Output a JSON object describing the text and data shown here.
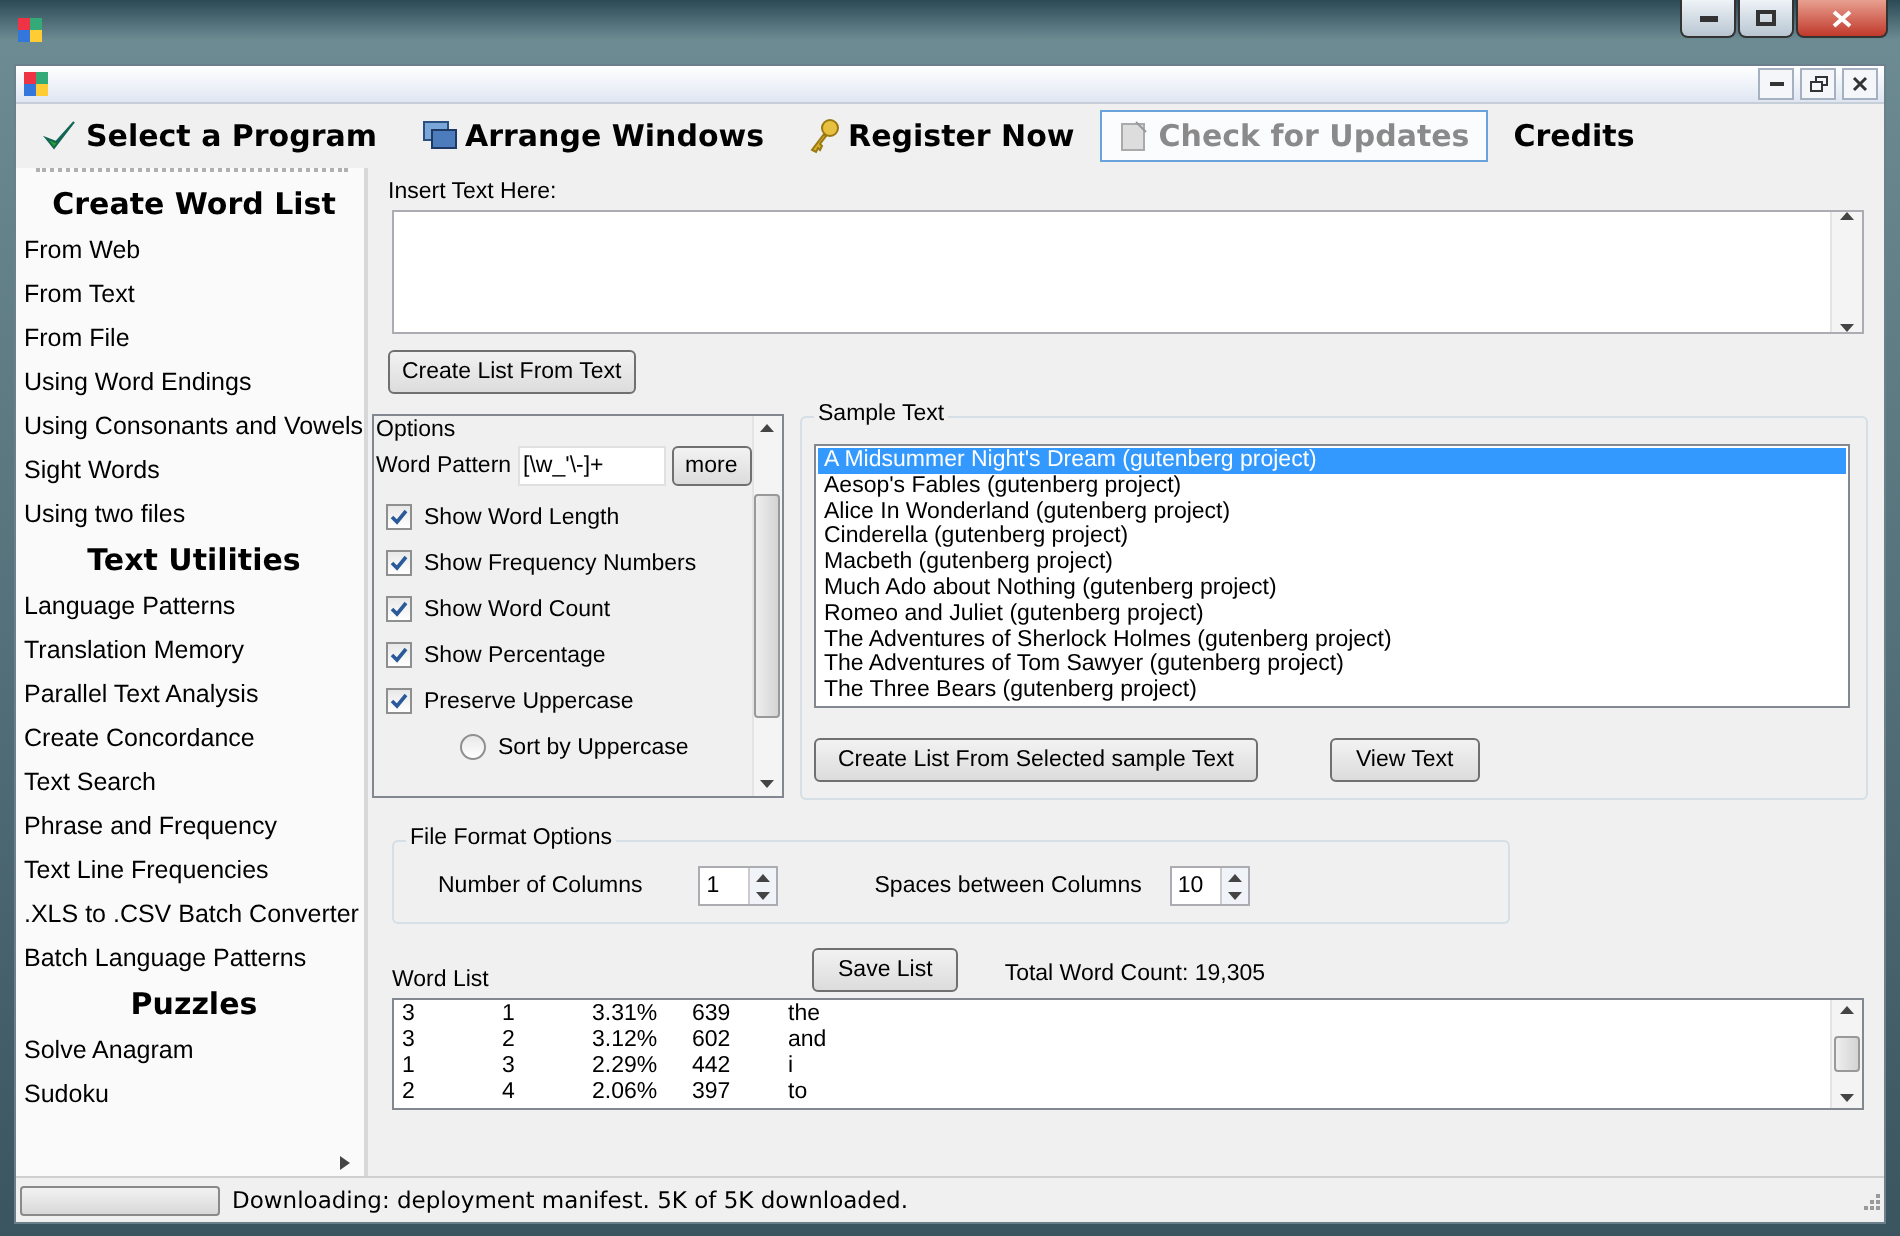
{
  "menu": [
    {
      "label": "Select a Program",
      "kind": "check",
      "selected": false,
      "disabled": false
    },
    {
      "label": "Arrange Windows",
      "kind": "windows",
      "selected": false,
      "disabled": false
    },
    {
      "label": "Register Now",
      "kind": "key",
      "selected": false,
      "disabled": false
    },
    {
      "label": "Check for Updates",
      "kind": "update",
      "selected": true,
      "disabled": true
    },
    {
      "label": "Credits",
      "kind": "plain",
      "selected": false,
      "disabled": false
    }
  ],
  "sidebar": {
    "sections": [
      {
        "heading": "Create Word List",
        "items": [
          "From Web",
          "From Text",
          "From File",
          "Using Word Endings",
          "Using Consonants and Vowels",
          "Sight Words",
          "Using two files"
        ]
      },
      {
        "heading": "Text Utilities",
        "items": [
          "Language Patterns",
          "Translation Memory",
          "Parallel Text Analysis",
          "Create Concordance",
          "Text Search",
          "Phrase and Frequency",
          "Text Line Frequencies",
          ".XLS to .CSV Batch Converter",
          "Batch Language Patterns"
        ]
      },
      {
        "heading": "Puzzles",
        "items": [
          "Solve Anagram",
          "Sudoku"
        ]
      }
    ]
  },
  "insert_text": {
    "label": "Insert Text Here:",
    "button": "Create List From Text"
  },
  "options": {
    "title": "Options",
    "pattern_label": "Word Pattern",
    "pattern_value": "[\\w_'\\-]+",
    "more_button": "more",
    "items": [
      {
        "kind": "checkbox",
        "label": "Show Word Length",
        "checked": true
      },
      {
        "kind": "checkbox",
        "label": "Show Frequency Numbers",
        "checked": true
      },
      {
        "kind": "checkbox",
        "label": "Show Word Count",
        "checked": true
      },
      {
        "kind": "checkbox",
        "label": "Show Percentage",
        "checked": true
      },
      {
        "kind": "checkbox",
        "label": "Preserve Uppercase",
        "checked": true
      },
      {
        "kind": "radio",
        "label": "Sort by Uppercase",
        "checked": false
      }
    ]
  },
  "sample_text": {
    "title": "Sample Text",
    "items": [
      {
        "label": "A Midsummer Night's Dream (gutenberg project)",
        "selected": true
      },
      {
        "label": "Aesop's Fables (gutenberg project)",
        "selected": false
      },
      {
        "label": "Alice In Wonderland (gutenberg project)",
        "selected": false
      },
      {
        "label": "Cinderella (gutenberg project)",
        "selected": false
      },
      {
        "label": "Macbeth (gutenberg project)",
        "selected": false
      },
      {
        "label": "Much Ado about Nothing (gutenberg project)",
        "selected": false
      },
      {
        "label": "Romeo and Juliet (gutenberg project)",
        "selected": false
      },
      {
        "label": "The Adventures of Sherlock Holmes (gutenberg project)",
        "selected": false
      },
      {
        "label": "The Adventures of Tom Sawyer (gutenberg project)",
        "selected": false
      },
      {
        "label": "The Three Bears (gutenberg project)",
        "selected": false
      }
    ],
    "buttons": [
      "Create List From Selected sample Text",
      "View Text"
    ]
  },
  "file_format": {
    "title": "File Format Options",
    "fields": [
      {
        "label": "Number of Columns",
        "value": "1"
      },
      {
        "label": "Spaces between Columns",
        "value": "10"
      }
    ]
  },
  "word_list": {
    "label": "Word List",
    "save_button": "Save List",
    "total": "Total Word Count: 19,305",
    "rows": [
      [
        "3",
        "1",
        "3.31%",
        "639",
        "the"
      ],
      [
        "3",
        "2",
        "3.12%",
        "602",
        "and"
      ],
      [
        "1",
        "3",
        "2.29%",
        "442",
        "i"
      ],
      [
        "2",
        "4",
        "2.06%",
        "397",
        "to"
      ]
    ]
  },
  "status_bar": {
    "level": 0,
    "text": "Downloading: deployment manifest. 5K of 5K downloaded."
  }
}
